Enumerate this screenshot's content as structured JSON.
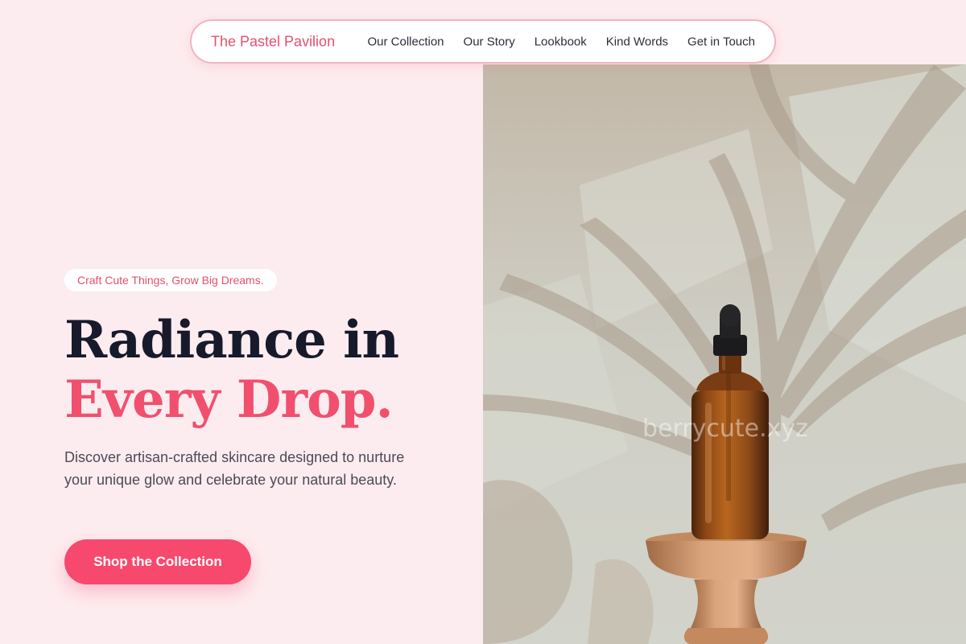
{
  "nav": {
    "brand": "The Pastel Pavilion",
    "links": [
      "Our Collection",
      "Our Story",
      "Lookbook",
      "Kind Words",
      "Get in Touch"
    ]
  },
  "hero": {
    "tagline": "Craft Cute Things, Grow Big Dreams.",
    "headline_line1": "Radiance in",
    "headline_line2": "Every Drop.",
    "description": "Discover artisan-crafted skincare designed to nurture your unique glow and celebrate your natural beauty.",
    "cta_label": "Shop the Collection"
  },
  "image": {
    "watermark": "berrycute.xyz",
    "alt_subject": "amber dropper bottle on wooden pedestal with palm leaf shadow"
  },
  "colors": {
    "page_background": "#fdecef",
    "brand_pink": "#e3506f",
    "accent_pink": "#f0506e",
    "button_pink": "#f7496d",
    "headline_dark": "#161a2b",
    "body_text": "#4a4b57"
  }
}
